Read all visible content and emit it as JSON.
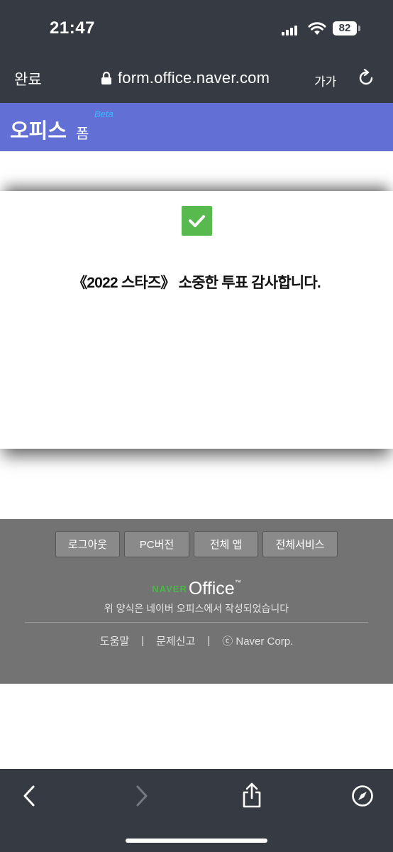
{
  "status_bar": {
    "time": "21:47",
    "battery": "82"
  },
  "browser": {
    "done_label": "완료",
    "url": "form.office.naver.com",
    "text_size_label": "가가"
  },
  "office_header": {
    "title": "오피스",
    "subtitle": "폼",
    "badge": "Beta"
  },
  "modal": {
    "message": "《2022 스타즈》 소중한 투표 감사합니다."
  },
  "footer": {
    "buttons": [
      "로그아웃",
      "PC버전",
      "전체 앱",
      "전체서비스"
    ],
    "brand_naver": "NAVER",
    "brand_office": "Office",
    "brand_tm": "™",
    "note": "위 양식은 네이버 오피스에서 작성되었습니다",
    "links": [
      "도움말",
      "문제신고",
      "ⓒ Naver Corp."
    ],
    "separator": "|"
  },
  "icons": {
    "status": [
      "signal-icon",
      "wifi-icon",
      "battery-icon"
    ],
    "toolbar": [
      "back-icon",
      "forward-icon",
      "share-icon",
      "compass-icon"
    ]
  },
  "colors": {
    "browser_chrome": "#363b43",
    "office_header": "#6270d6",
    "success_check": "#57b94e",
    "footer_bg": "#737373",
    "naver_green": "#4ab847"
  }
}
